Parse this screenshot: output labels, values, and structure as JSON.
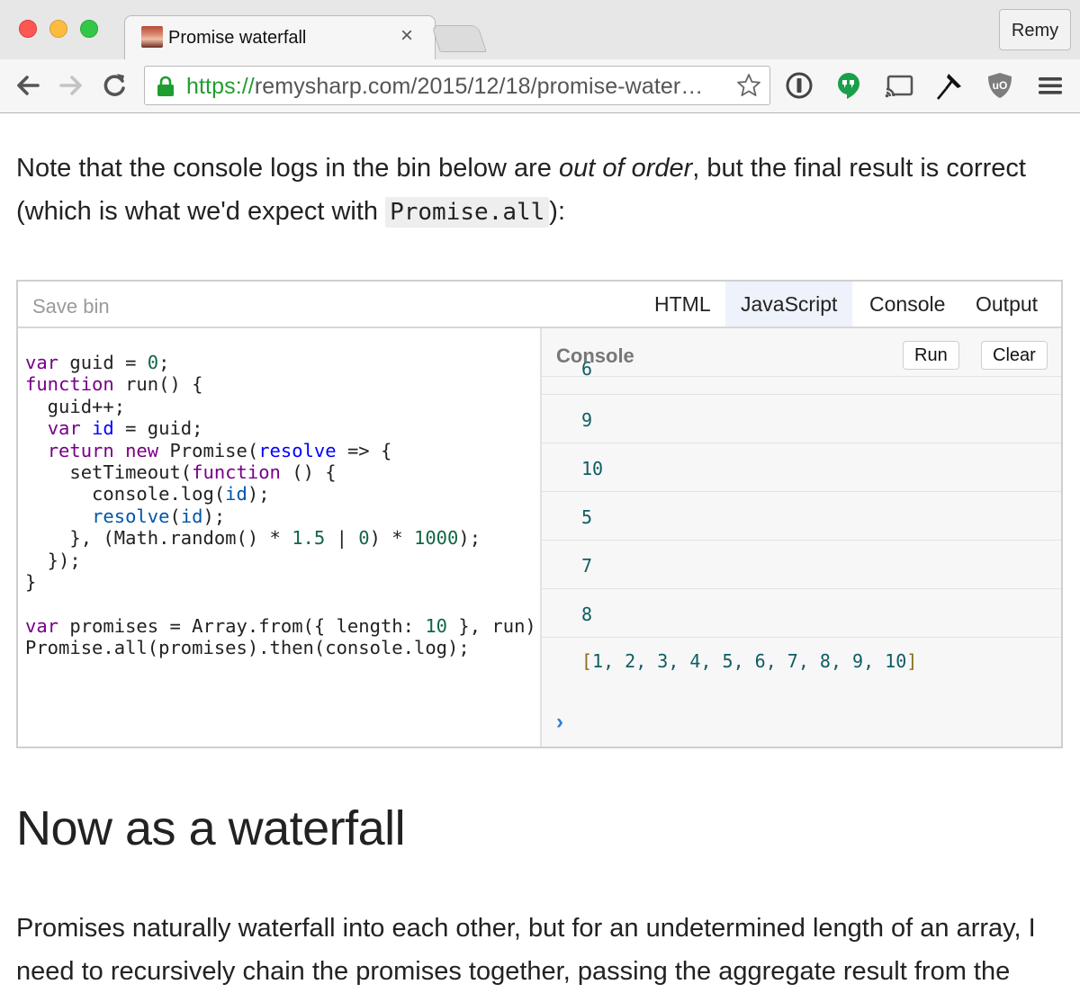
{
  "window": {
    "tab_title": "Promise waterfall",
    "tab_close": "×",
    "profile_name": "Remy"
  },
  "toolbar": {
    "url_scheme": "https://",
    "url_rest": "remysharp.com/2015/12/18/promise-water…",
    "icons": [
      "back-arrow-icon",
      "forward-arrow-icon",
      "reload-icon",
      "lock-icon",
      "bookmark-star-icon",
      "1password-icon",
      "hangouts-icon",
      "cast-icon",
      "pin-icon",
      "ublock-icon",
      "menu-icon"
    ]
  },
  "content": {
    "intro_before_em": "Note that the console logs in the bin below are ",
    "intro_em": "out of order",
    "intro_after_em": ", but the final result is correct (which is what we'd expect with ",
    "intro_code": "Promise.all",
    "intro_end": "):",
    "heading": "Now as a waterfall",
    "outro": "Promises naturally waterfall into each other, but for an undetermined length of an array, I need to recursively chain the promises together, passing the aggregate result from the"
  },
  "bin": {
    "save_label": "Save bin",
    "tabs": [
      "HTML",
      "JavaScript",
      "Console",
      "Output"
    ],
    "active_tab": "JavaScript",
    "code_lines": [
      "var guid = 0;",
      "function run() {",
      "  guid++;",
      "  var id = guid;",
      "  return new Promise(resolve => {",
      "    setTimeout(function () {",
      "      console.log(id);",
      "      resolve(id);",
      "    }, (Math.random() * 1.5 | 0) * 1000);",
      "  });",
      "}",
      "",
      "var promises = Array.from({ length: 10 }, run)",
      "Promise.all(promises).then(console.log);"
    ],
    "console": {
      "title": "Console",
      "run_label": "Run",
      "clear_label": "Clear",
      "log_values": [
        "6",
        "9",
        "10",
        "5",
        "7",
        "8"
      ],
      "result": "[1, 2, 3, 4, 5, 6, 7, 8, 9, 10]",
      "prompt": "›"
    }
  },
  "colors": {
    "keyword": "#770088",
    "definition": "#0000ff",
    "number": "#116644",
    "variable": "#0055aa",
    "console_value": "#0e5d63",
    "url_scheme": "#1f9e2f"
  }
}
